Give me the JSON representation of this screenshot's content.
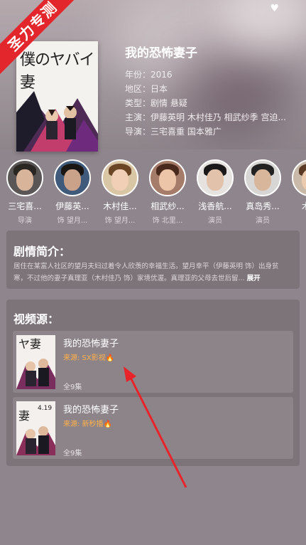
{
  "badge": "圣力专测",
  "movie": {
    "title": "我的恐怖妻子",
    "year": "年份：2016",
    "region": "地区：日本",
    "genre": "类型：剧情 悬疑",
    "starring": "主演：伊藤英明 木村佳乃 相武纱季 宫迫...",
    "director": "导演：三宅喜重 国本雅广",
    "poster_text": "僕のヤバイ妻"
  },
  "cast": [
    {
      "name": "三宅喜...",
      "role": "导演"
    },
    {
      "name": "伊藤英...",
      "role": "饰 望月..."
    },
    {
      "name": "木村佳...",
      "role": "饰 望月..."
    },
    {
      "name": "相武纱...",
      "role": "饰 北里..."
    },
    {
      "name": "浅香航...",
      "role": "演员"
    },
    {
      "name": "真岛秀...",
      "role": "演员"
    },
    {
      "name": "木村",
      "role": "饰"
    }
  ],
  "synopsis": {
    "heading": "剧情简介：",
    "text": "居住在某富人社区的望月夫妇过着令人欣羡的幸福生活。望月幸平（伊藤英明 饰）出身贫寒，不过他的妻子真理亚（木村佳乃 饰）家境优渥。真理亚的父母去世后留...",
    "more": "展开"
  },
  "sources": {
    "heading": "视频源：",
    "items": [
      {
        "title": "我的恐怖妻子",
        "from": "来源: SX影视🔥",
        "episodes": "全9集"
      },
      {
        "title": "我的恐怖妻子",
        "from": "来源: 新秒播🔥",
        "episodes": "全9集"
      }
    ]
  },
  "colors": {
    "accent": "#e3262b",
    "source": "#ffb04a",
    "background": "#8f868d"
  }
}
